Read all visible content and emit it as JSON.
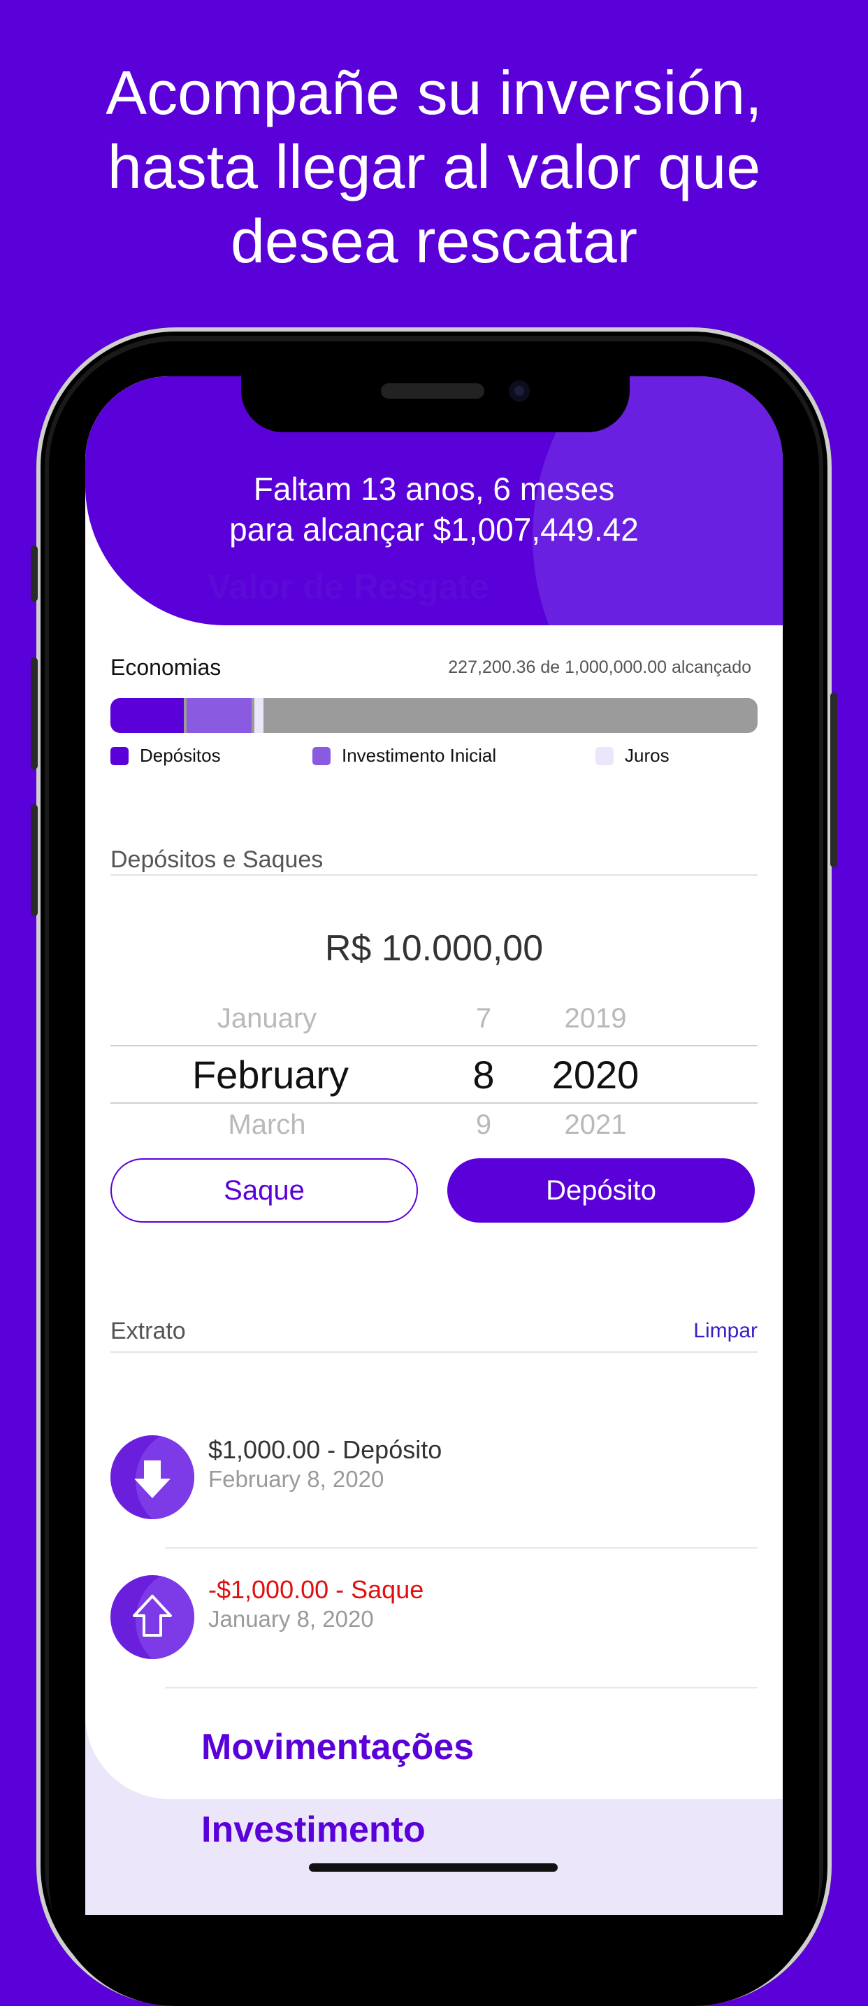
{
  "headline": {
    "line1": "Acompañe su inversión,",
    "line2": "hasta llegar al valor que",
    "line3": "desea rescatar"
  },
  "header": {
    "line1": "Faltam 13 anos, 6 meses",
    "line2": "para alcançar $1,007,449.42",
    "ghost_label": "Valor de Resgate"
  },
  "savings": {
    "title": "Economias",
    "progress_text": "227,200.36 de 1,000,000.00 alcançado",
    "segments": [
      {
        "name": "Depósitos",
        "fraction": 0.113,
        "color": "#5a00d8"
      },
      {
        "name": "Investimento Inicial",
        "fraction": 0.1,
        "color": "#8a5ae0"
      },
      {
        "name": "Juros",
        "fraction": 0.014,
        "color": "#ece6fb"
      }
    ],
    "legend": {
      "deposits": "Depósitos",
      "initial": "Investimento Inicial",
      "interest": "Juros"
    }
  },
  "deposits_section": {
    "title": "Depósitos e Saques",
    "amount": "R$ 10.000,00",
    "picker": {
      "prev": {
        "month": "January",
        "day": "7",
        "year": "2019"
      },
      "selected": {
        "month": "February",
        "day": "8",
        "year": "2020"
      },
      "next": {
        "month": "March",
        "day": "9",
        "year": "2021"
      }
    },
    "withdraw_label": "Saque",
    "deposit_label": "Depósito"
  },
  "statement": {
    "title": "Extrato",
    "clear_label": "Limpar",
    "items": [
      {
        "title": "$1,000.00 - Depósito",
        "date": "February 8, 2020",
        "color": "#333333",
        "icon": "arrow-down-icon"
      },
      {
        "title": "-$1,000.00 - Saque",
        "date": "January 8, 2020",
        "color": "#e01010",
        "icon": "arrow-up-outline-icon"
      }
    ]
  },
  "tabs": {
    "movements": "Movimentações",
    "investment": "Investimento"
  },
  "colors": {
    "brand": "#5a00d8",
    "danger": "#e01010"
  }
}
